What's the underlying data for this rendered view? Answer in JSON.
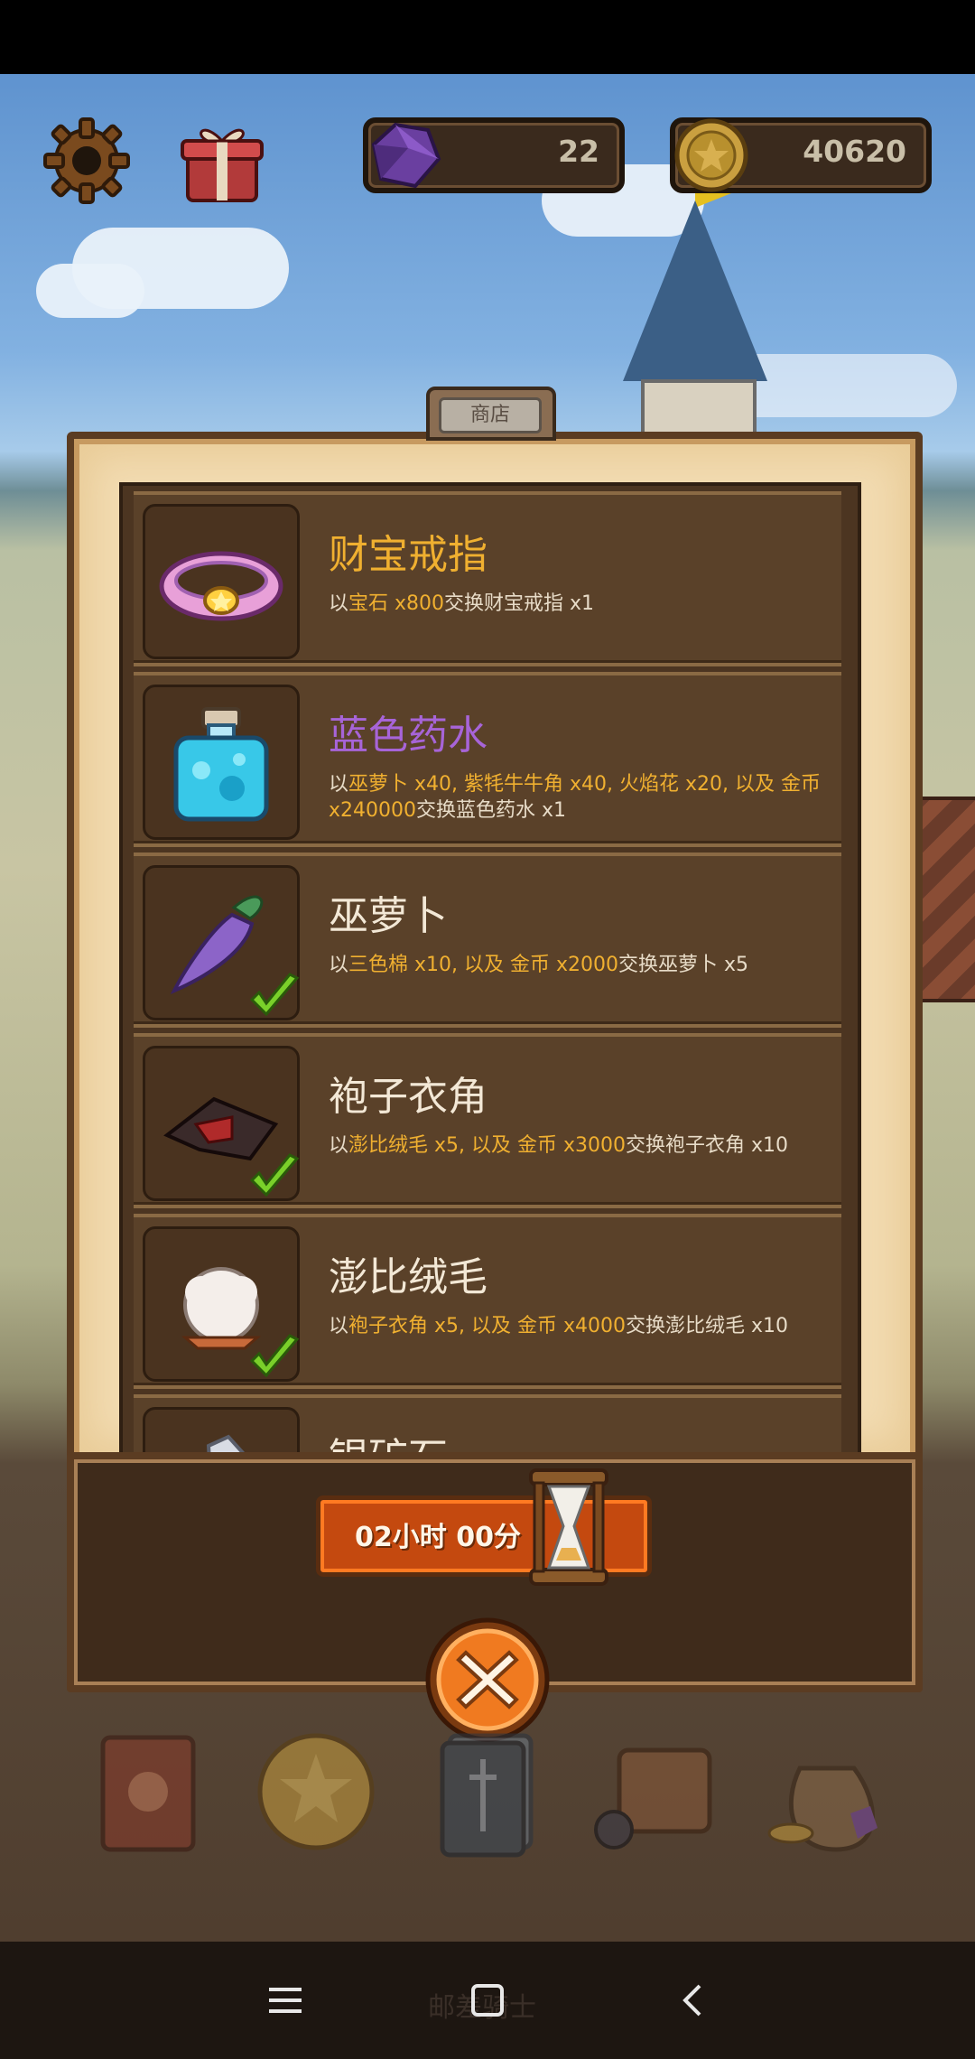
{
  "hud": {
    "gems": "22",
    "coins": "40620"
  },
  "shop": {
    "tab_label": "商店",
    "items": [
      {
        "title": "财宝戒指",
        "title_color": "#f0b030",
        "desc_parts": [
          "以",
          "宝石 x800",
          "交换财宝戒指 x1"
        ],
        "completed": false
      },
      {
        "title": "蓝色药水",
        "title_color": "#a764d8",
        "desc_parts": [
          "以",
          "巫萝卜 x40, 紫牦牛牛角 x40, 火焰花 x20, 以及 金币 x240000",
          "交换蓝色药水 x1"
        ],
        "completed": false
      },
      {
        "title": "巫萝卜",
        "title_color": "#f3e8d6",
        "desc_parts": [
          "以",
          "三色棉 x10, 以及 金币 x2000",
          "交换巫萝卜 x5"
        ],
        "completed": true
      },
      {
        "title": "袍子衣角",
        "title_color": "#f3e8d6",
        "desc_parts": [
          "以",
          "澎比绒毛 x5, 以及 金币 x3000",
          "交换袍子衣角 x10"
        ],
        "completed": true
      },
      {
        "title": "澎比绒毛",
        "title_color": "#f3e8d6",
        "desc_parts": [
          "以",
          "袍子衣角 x5, 以及 金币 x4000",
          "交换澎比绒毛 x10"
        ],
        "completed": true
      },
      {
        "title": "银矿石",
        "title_color": "#f3e8d6",
        "desc_parts": [
          "",
          "",
          ""
        ],
        "completed": false
      }
    ]
  },
  "timer": {
    "text": "02小时 00分"
  },
  "dock": {
    "label": "邮差骑士"
  },
  "icons": {
    "settings": "gear-icon",
    "gift": "gift-icon",
    "gem": "gem-icon",
    "coin": "coin-icon",
    "close": "close-icon",
    "hourglass": "hourglass-icon"
  }
}
